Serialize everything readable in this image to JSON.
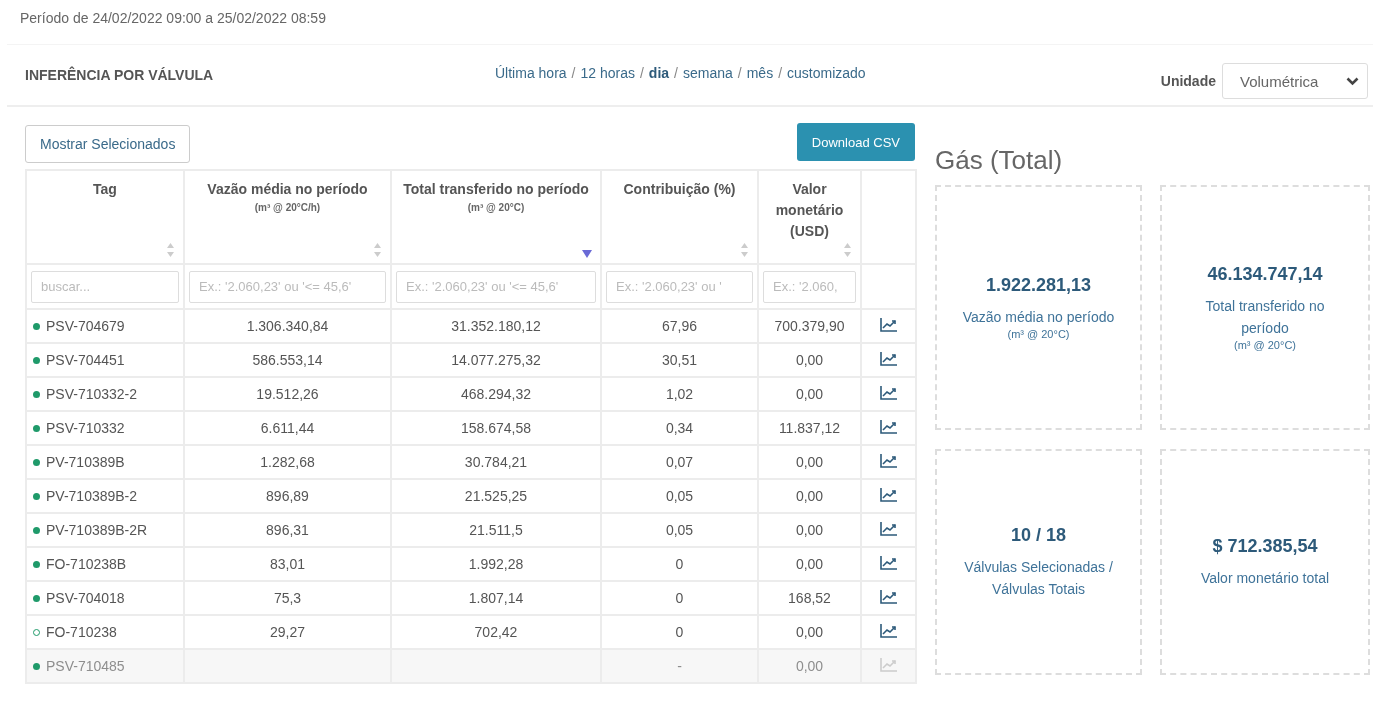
{
  "period": "Período de 24/02/2022 09:00 a 25/02/2022 08:59",
  "section_title": "INFERÊNCIA POR VÁLVULA",
  "time_range": {
    "separator": "/",
    "options": [
      {
        "label": "Última hora",
        "selected": false
      },
      {
        "label": "12 horas",
        "selected": false
      },
      {
        "label": "dia",
        "selected": true
      },
      {
        "label": "semana",
        "selected": false
      },
      {
        "label": "mês",
        "selected": false
      },
      {
        "label": "customizado",
        "selected": false
      }
    ]
  },
  "unit": {
    "label": "Unidade",
    "value": "Volumétrica"
  },
  "buttons": {
    "show_selected": "Mostrar Selecionados",
    "download": "Download CSV"
  },
  "table": {
    "columns": [
      {
        "title": "Tag",
        "sorted": false,
        "filter_placeholder": "buscar..."
      },
      {
        "title": "Vazão média no período",
        "unit": "(m³ @ 20°C/h)",
        "sorted": false,
        "filter_placeholder": "Ex.: '2.060,23' ou '<= 45,6'"
      },
      {
        "title": "Total transferido no período",
        "unit": "(m³ @ 20°C)",
        "sorted": true,
        "filter_placeholder": "Ex.: '2.060,23' ou '<= 45,6'"
      },
      {
        "title": "Contribuição (%)",
        "sorted": false,
        "filter_placeholder": "Ex.: '2.060,23' ou '"
      },
      {
        "title": "Valor monetário (USD)",
        "sorted": false,
        "filter_placeholder": "Ex.: '2.060,"
      }
    ],
    "rows": [
      {
        "selected": true,
        "disabled": false,
        "cells": [
          "PSV-704679",
          "1.306.340,84",
          "31.352.180,12",
          "67,96",
          "700.379,90"
        ]
      },
      {
        "selected": true,
        "disabled": false,
        "cells": [
          "PSV-704451",
          "586.553,14",
          "14.077.275,32",
          "30,51",
          "0,00"
        ]
      },
      {
        "selected": true,
        "disabled": false,
        "cells": [
          "PSV-710332-2",
          "19.512,26",
          "468.294,32",
          "1,02",
          "0,00"
        ]
      },
      {
        "selected": true,
        "disabled": false,
        "cells": [
          "PSV-710332",
          "6.611,44",
          "158.674,58",
          "0,34",
          "11.837,12"
        ]
      },
      {
        "selected": true,
        "disabled": false,
        "cells": [
          "PV-710389B",
          "1.282,68",
          "30.784,21",
          "0,07",
          "0,00"
        ]
      },
      {
        "selected": true,
        "disabled": false,
        "cells": [
          "PV-710389B-2",
          "896,89",
          "21.525,25",
          "0,05",
          "0,00"
        ]
      },
      {
        "selected": true,
        "disabled": false,
        "cells": [
          "PV-710389B-2R",
          "896,31",
          "21.511,5",
          "0,05",
          "0,00"
        ]
      },
      {
        "selected": true,
        "disabled": false,
        "cells": [
          "FO-710238B",
          "83,01",
          "1.992,28",
          "0",
          "0,00"
        ]
      },
      {
        "selected": true,
        "disabled": false,
        "cells": [
          "PSV-704018",
          "75,3",
          "1.807,14",
          "0",
          "168,52"
        ]
      },
      {
        "selected": false,
        "disabled": false,
        "cells": [
          "FO-710238",
          "29,27",
          "702,42",
          "0",
          "0,00"
        ]
      },
      {
        "selected": true,
        "disabled": true,
        "cells": [
          "PSV-710485",
          "",
          "",
          "-",
          "0,00"
        ]
      }
    ]
  },
  "summary": {
    "title": "Gás (Total)",
    "cards": [
      {
        "value": "1.922.281,13",
        "label": "Vazão média no período",
        "unit": "(m³ @ 20°C)"
      },
      {
        "value": "46.134.747,14",
        "label": "Total transferido no período",
        "unit": "(m³ @ 20°C)"
      },
      {
        "value": "10 / 18",
        "label": "Válvulas Selecionadas / Válvulas Totais"
      },
      {
        "value": "$ 712.385,54",
        "label": "Valor monetário total"
      }
    ]
  }
}
